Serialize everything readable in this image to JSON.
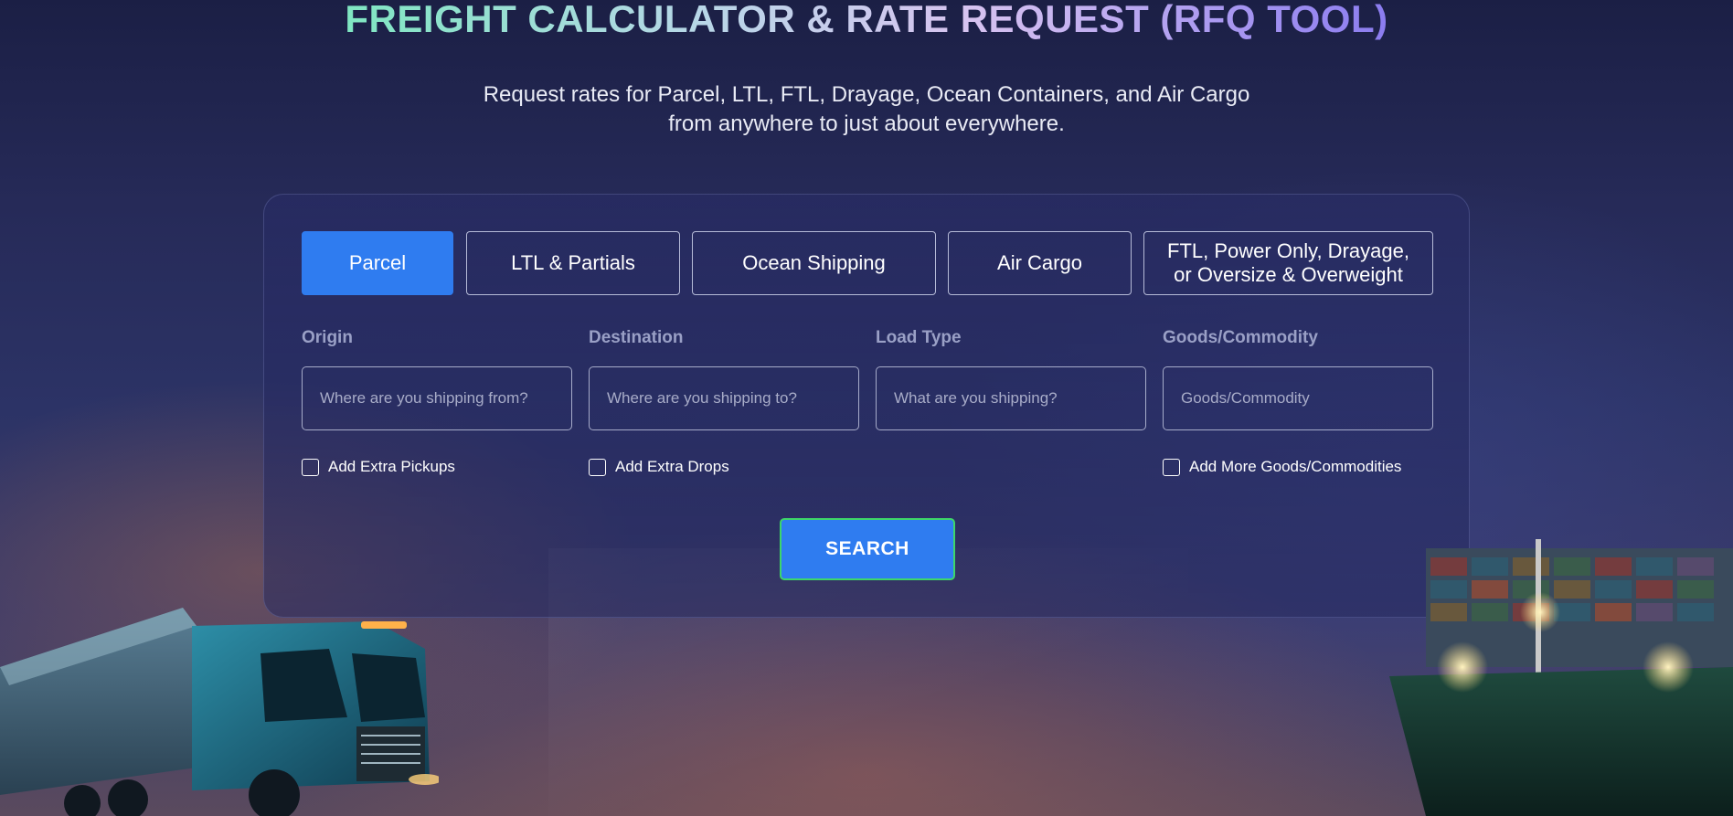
{
  "header": {
    "title": "FREIGHT CALCULATOR & RATE REQUEST (RFQ TOOL)",
    "subtitle_line1": "Request rates for Parcel, LTL, FTL, Drayage, Ocean Containers, and Air Cargo",
    "subtitle_line2": "from anywhere to just about everywhere."
  },
  "tabs": [
    {
      "label": "Parcel",
      "active": true
    },
    {
      "label": "LTL & Partials",
      "active": false
    },
    {
      "label": "Ocean Shipping",
      "active": false
    },
    {
      "label": "Air Cargo",
      "active": false
    },
    {
      "label_line1": "FTL, Power Only, Drayage,",
      "label_line2": "or Oversize & Overweight",
      "active": false
    }
  ],
  "fields": {
    "origin": {
      "label": "Origin",
      "placeholder": "Where are you shipping from?",
      "value": ""
    },
    "destination": {
      "label": "Destination",
      "placeholder": "Where are you shipping to?",
      "value": ""
    },
    "load_type": {
      "label": "Load Type",
      "placeholder": "What are you shipping?",
      "value": ""
    },
    "goods": {
      "label": "Goods/Commodity",
      "placeholder": "Goods/Commodity",
      "value": ""
    }
  },
  "checkboxes": {
    "extra_pickups": {
      "label": "Add Extra Pickups",
      "checked": false
    },
    "extra_drops": {
      "label": "Add Extra Drops",
      "checked": false
    },
    "more_goods": {
      "label": "Add More Goods/Commodities",
      "checked": false
    }
  },
  "search_button": {
    "label": "SEARCH"
  },
  "colors": {
    "accent_blue": "#2f7cf0",
    "search_border_green": "#3dd66a",
    "title_gradient_start": "#7fe6c2",
    "title_gradient_end": "#8b7cf0"
  },
  "illustrations": [
    "semi-truck-illustration",
    "container-ship-illustration"
  ]
}
